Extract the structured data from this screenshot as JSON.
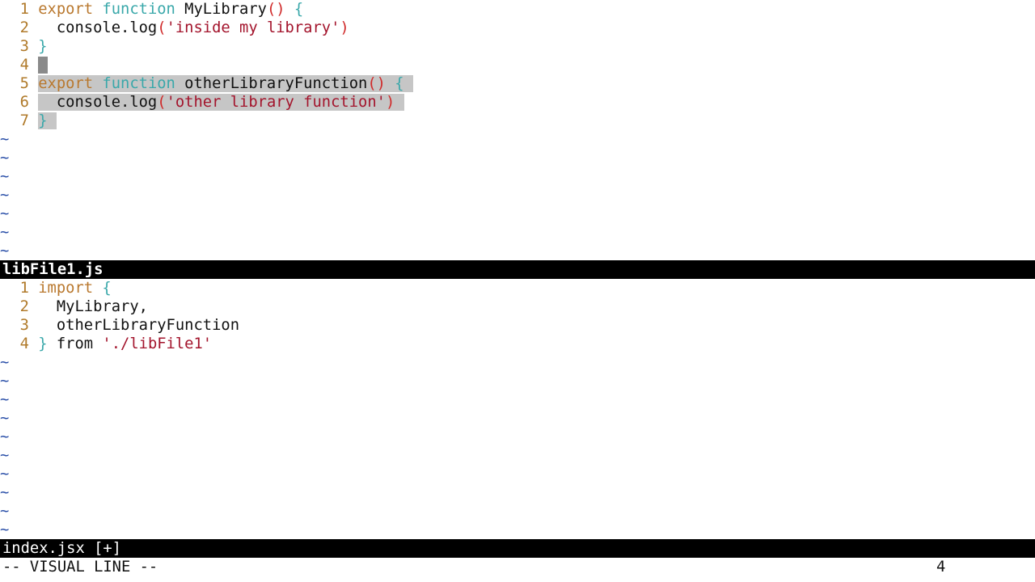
{
  "top_pane": {
    "filename": "libFile1.js",
    "lines": [
      {
        "n": "1",
        "tokens": [
          [
            "export ",
            "kw"
          ],
          [
            "function ",
            "fn"
          ],
          [
            "MyLibrary",
            "id"
          ],
          [
            "()",
            "par"
          ],
          [
            " ",
            "id"
          ],
          [
            "{",
            "br"
          ]
        ]
      },
      {
        "n": "2",
        "tokens": [
          [
            "  console.log",
            "id"
          ],
          [
            "(",
            "par"
          ],
          [
            "'inside my library'",
            "str"
          ],
          [
            ")",
            "par"
          ]
        ]
      },
      {
        "n": "3",
        "tokens": [
          [
            "}",
            "br"
          ]
        ]
      },
      {
        "n": "4",
        "tokens": [
          [
            " ",
            "cur"
          ]
        ]
      },
      {
        "n": "5",
        "sel": true,
        "tokens": [
          [
            "export ",
            "kw"
          ],
          [
            "function ",
            "fn"
          ],
          [
            "otherLibraryFunction",
            "id"
          ],
          [
            "()",
            "par"
          ],
          [
            " ",
            "id"
          ],
          [
            "{",
            "br"
          ],
          [
            " ",
            "id"
          ]
        ]
      },
      {
        "n": "6",
        "sel": true,
        "tokens": [
          [
            "  console.log",
            "id"
          ],
          [
            "(",
            "par"
          ],
          [
            "'other library function'",
            "str"
          ],
          [
            ")",
            "par"
          ],
          [
            " ",
            "id"
          ]
        ]
      },
      {
        "n": "7",
        "sel": true,
        "tokens": [
          [
            "}",
            "br"
          ],
          [
            " ",
            "id"
          ]
        ]
      }
    ],
    "tilde_rows": 7
  },
  "bottom_pane": {
    "filename": "index.jsx [+]",
    "lines": [
      {
        "n": "1",
        "tokens": [
          [
            "import ",
            "kw"
          ],
          [
            "{",
            "br"
          ]
        ]
      },
      {
        "n": "2",
        "tokens": [
          [
            "  MyLibrary,",
            "id"
          ]
        ]
      },
      {
        "n": "3",
        "tokens": [
          [
            "  otherLibraryFunction",
            "id"
          ]
        ]
      },
      {
        "n": "4",
        "tokens": [
          [
            "}",
            "br"
          ],
          [
            " from ",
            "id"
          ],
          [
            "'./libFile1'",
            "str"
          ]
        ]
      }
    ],
    "tilde_rows": 10
  },
  "command_line": {
    "mode": "-- VISUAL LINE --",
    "selection_count": "4"
  },
  "tilde_char": "~"
}
